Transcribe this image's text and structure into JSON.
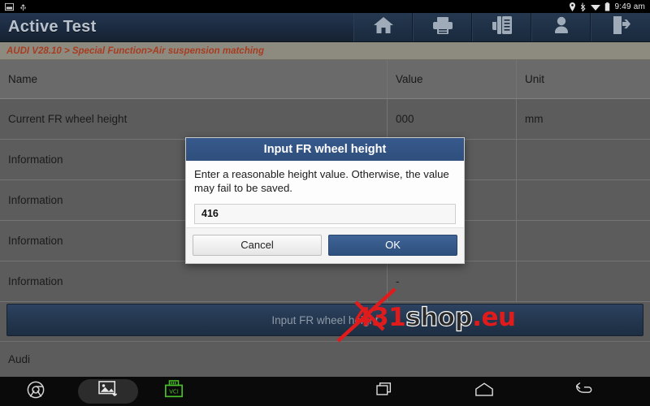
{
  "statusbar": {
    "left_icons": [
      "screenshot-icon",
      "usb-icon"
    ],
    "right_icons": [
      "location-icon",
      "bluetooth-icon",
      "wifi-icon",
      "battery-icon"
    ],
    "clock": "9:49 am"
  },
  "header": {
    "title": "Active Test",
    "toolbar": [
      {
        "name": "home-icon",
        "label": "Home"
      },
      {
        "name": "print-icon",
        "label": "Print"
      },
      {
        "name": "report-icon",
        "label": "Report"
      },
      {
        "name": "user-icon",
        "label": "User"
      },
      {
        "name": "exit-icon",
        "label": "Exit"
      }
    ]
  },
  "breadcrumb": {
    "text": "AUDI V28.10 > Special Function>Air suspension matching",
    "color": "#a83c20"
  },
  "table": {
    "columns": [
      "Name",
      "Value",
      "Unit"
    ],
    "rows": [
      {
        "name": "Current FR wheel height",
        "value": "000",
        "unit": "mm"
      },
      {
        "name": "Information",
        "value": "",
        "unit": ""
      },
      {
        "name": "Information",
        "value": "",
        "unit": ""
      },
      {
        "name": "Information",
        "value": "",
        "unit": ""
      },
      {
        "name": "Information",
        "value": "-",
        "unit": ""
      }
    ]
  },
  "action_button": {
    "label": "Input FR wheel height"
  },
  "footer": {
    "label": "Audi"
  },
  "dialog": {
    "title": "Input FR wheel height",
    "message": "Enter a reasonable height value. Otherwise, the value may fail to be saved.",
    "input_value": "416",
    "input_placeholder": "",
    "cancel_label": "Cancel",
    "ok_label": "OK",
    "title_bg": "#2f4f7d",
    "ok_bg": "#2d4f7e"
  },
  "watermark": {
    "part1": "431",
    "part2": "shop",
    "part3": ".eu",
    "color": "#e01b1b"
  },
  "navbar": {
    "left": [
      "chrome-icon",
      "screenshot-icon",
      "vci-icon"
    ],
    "vci_label": "VCI",
    "right": [
      "recents-icon",
      "home-icon",
      "back-icon"
    ]
  }
}
